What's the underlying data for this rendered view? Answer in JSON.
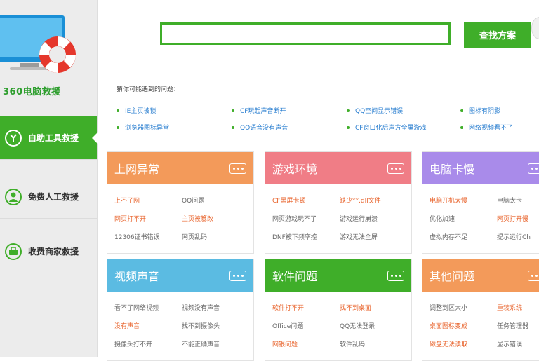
{
  "sidebar": {
    "logo_text": "360电脑救援",
    "items": [
      {
        "label": "自助工具救援",
        "active": true
      },
      {
        "label": "免费人工救援",
        "active": false
      },
      {
        "label": "收费商家救援",
        "active": false
      }
    ]
  },
  "search": {
    "value": "",
    "button_label": "查找方案"
  },
  "suggest": {
    "title": "猜你可能遇到的问题：",
    "items": [
      "IE主页被锁",
      "CF玩起声音断开",
      "QQ空间显示错误",
      "图标有阴影",
      "浏览器图标异常",
      "QQ语音没有声音",
      "CF窗口化后声方全屏游戏",
      "网络视频看不了"
    ]
  },
  "cards": [
    {
      "title": "上网异常",
      "color": "#f39a5a",
      "links": [
        {
          "text": "上不了网",
          "hot": true
        },
        {
          "text": "QQ问题",
          "hot": false
        },
        {
          "text": "网页打不开",
          "hot": true
        },
        {
          "text": "主页被篡改",
          "hot": true
        },
        {
          "text": "12306证书错误",
          "hot": false
        },
        {
          "text": "网页乱码",
          "hot": false
        }
      ]
    },
    {
      "title": "游戏环境",
      "color": "#f07d86",
      "links": [
        {
          "text": "CF黑屏卡顿",
          "hot": true
        },
        {
          "text": "缺少**.dll文件",
          "hot": true
        },
        {
          "text": "网页游戏玩不了",
          "hot": false
        },
        {
          "text": "游戏运行崩溃",
          "hot": false
        },
        {
          "text": "DNF被下频率控",
          "hot": false
        },
        {
          "text": "游戏无法全屏",
          "hot": false
        }
      ]
    },
    {
      "title": "电脑卡慢",
      "color": "#a98bea",
      "links": [
        {
          "text": "电脑开机太慢",
          "hot": true
        },
        {
          "text": "电脑太卡",
          "hot": false
        },
        {
          "text": "优化加速",
          "hot": false
        },
        {
          "text": "网页打开慢",
          "hot": true
        },
        {
          "text": "虚拟内存不足",
          "hot": false
        },
        {
          "text": "提示运行Ch",
          "hot": false
        }
      ]
    },
    {
      "title": "视频声音",
      "color": "#5bbbe2",
      "links": [
        {
          "text": "看不了网络视频",
          "hot": false
        },
        {
          "text": "视频没有声音",
          "hot": false
        },
        {
          "text": "没有声音",
          "hot": true
        },
        {
          "text": "找不到摄像头",
          "hot": false
        },
        {
          "text": "摄像头打不开",
          "hot": false
        },
        {
          "text": "不能正确声音",
          "hot": false
        }
      ]
    },
    {
      "title": "软件问题",
      "color": "#3fae29",
      "links": [
        {
          "text": "软件打不开",
          "hot": true
        },
        {
          "text": "找不到桌面",
          "hot": true
        },
        {
          "text": "Office问题",
          "hot": false
        },
        {
          "text": "QQ无法登录",
          "hot": false
        },
        {
          "text": "网银问题",
          "hot": true
        },
        {
          "text": "软件乱码",
          "hot": false
        }
      ]
    },
    {
      "title": "其他问题",
      "color": "#f39a5a",
      "links": [
        {
          "text": "调整到区大小",
          "hot": false
        },
        {
          "text": "重装系统",
          "hot": true
        },
        {
          "text": "桌面图标变成",
          "hot": true
        },
        {
          "text": "任务管理器",
          "hot": false
        },
        {
          "text": "磁盘无法读取",
          "hot": true
        },
        {
          "text": "显示错误",
          "hot": false
        }
      ]
    }
  ]
}
